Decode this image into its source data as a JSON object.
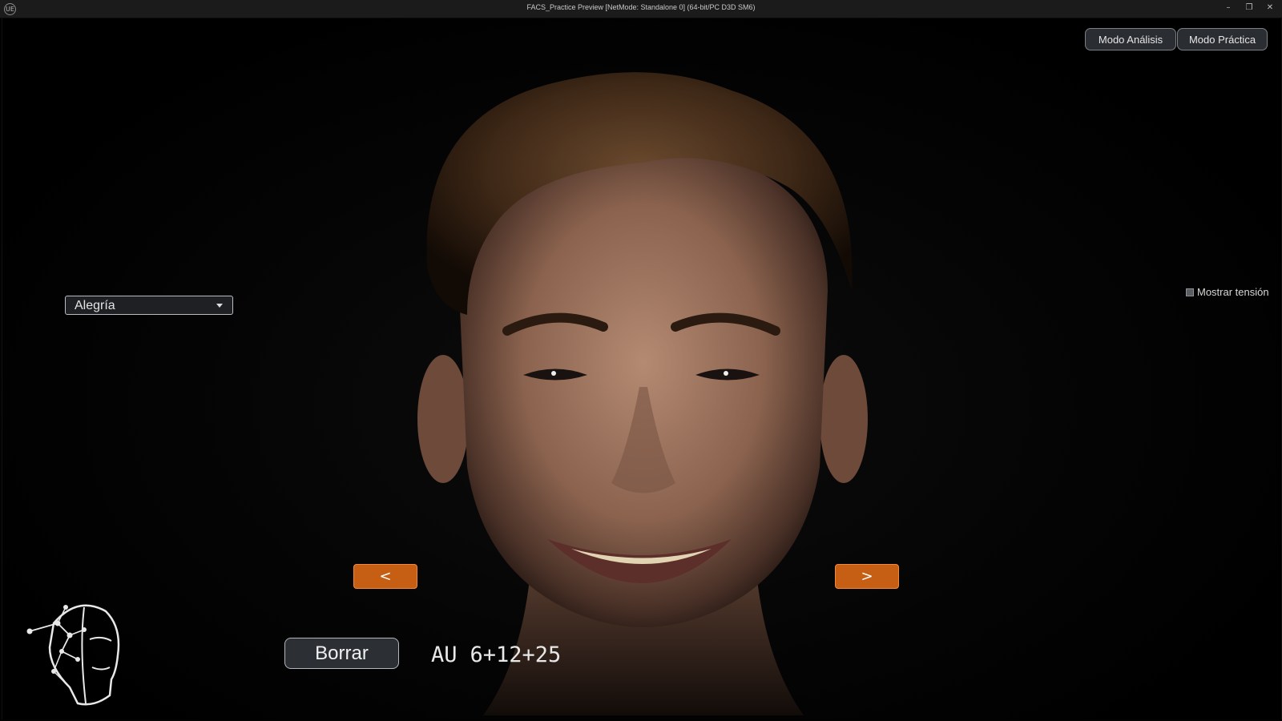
{
  "window": {
    "title": "FACS_Practice Preview [NetMode: Standalone 0]  (64-bit/PC D3D SM6)",
    "logo_glyph": "UE",
    "minimize_glyph": "–",
    "maximize_glyph": "❐",
    "close_glyph": "✕"
  },
  "header": {
    "analysis_mode_label": "Modo Análisis",
    "practice_mode_label": "Modo Práctica"
  },
  "emotion_select": {
    "selected": "Alegría"
  },
  "tension_toggle": {
    "label": "Mostrar tensión",
    "checked": false
  },
  "navigation": {
    "prev_label": "<",
    "next_label": ">"
  },
  "actions": {
    "clear_label": "Borrar"
  },
  "action_units": {
    "prefix": "AU",
    "code": "6+12+25"
  },
  "icons": {
    "app_logo": "face-network-logo-icon",
    "dropdown": "chevron-down-icon"
  }
}
